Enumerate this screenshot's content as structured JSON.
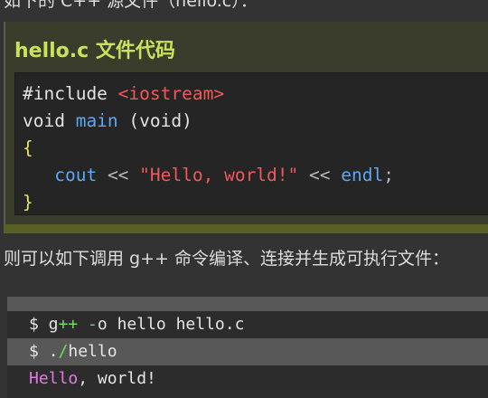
{
  "intro_text": "如下的 C++ 源文件（hello.c）：",
  "example": {
    "title": "hello.c 文件代码",
    "code": {
      "line1_kw": "#include ",
      "line1_str": "<iostream>",
      "line2_a": "void ",
      "line2_fn": "main",
      "line2_b": " (void)",
      "line3_brace": "{",
      "line4_indent": "   ",
      "line4_cout": "cout",
      "line4_op1": " << ",
      "line4_str": "\"Hello, world!\"",
      "line4_op2": " << ",
      "line4_endl": "endl",
      "line4_semi": ";",
      "line5_brace": "}"
    }
  },
  "paragraph": "则可以如下调用 g++ 命令编译、连接并生成可执行文件：",
  "terminal": {
    "cmd1_prompt": "$ g",
    "cmd1_pp": "++",
    "cmd1_dash": " -",
    "cmd1_rest": "o hello hello.c",
    "cmd2_prompt": "$ .",
    "cmd2_slash": "/",
    "cmd2_rest": "hello",
    "out_hello": "Hello",
    "out_rest": ", world!"
  },
  "colors": {
    "title": "#c8e35b",
    "string": "#f1595a",
    "function": "#5da8f5",
    "brace": "#e8e46b",
    "shell_op": "#6fdc5a",
    "output_word": "#e27ae6"
  }
}
